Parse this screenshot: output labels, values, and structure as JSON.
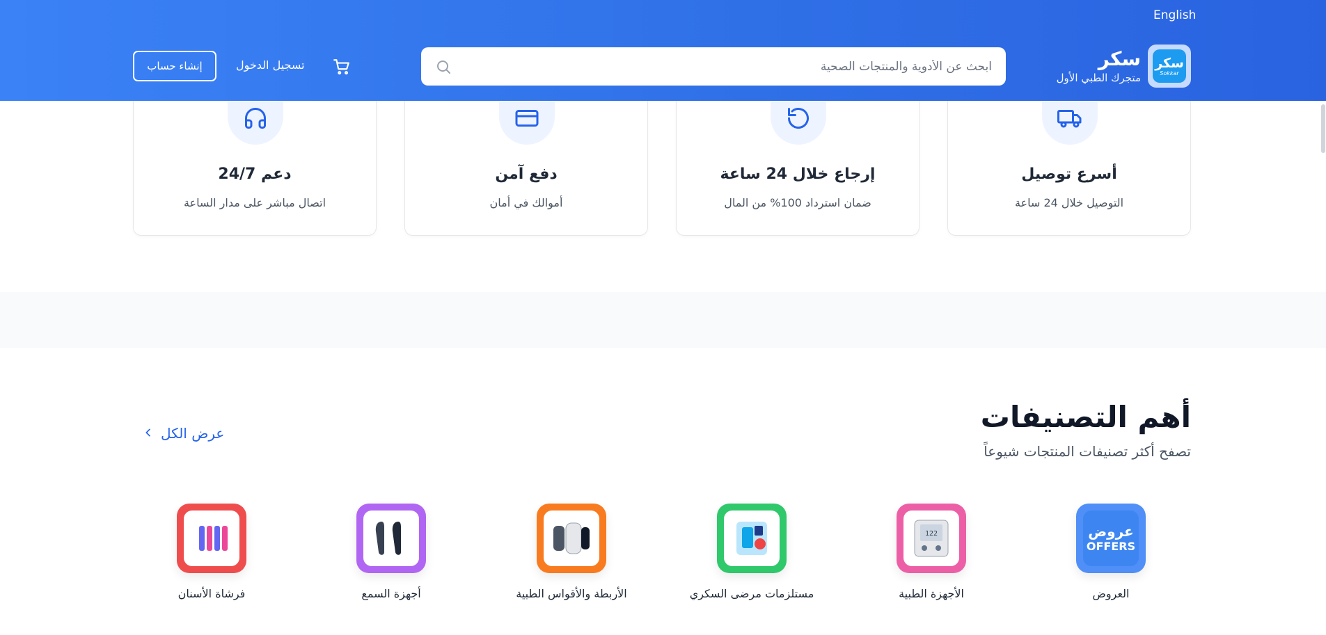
{
  "header": {
    "language_link": "English",
    "brand_name": "سكر",
    "brand_tagline": "متجرك الطبي الأول",
    "logo_text_ar": "سكر",
    "logo_text_en": "Sokkar",
    "search_placeholder": "ابحث عن الأدوية والمنتجات الصحية",
    "login_label": "تسجيل الدخول",
    "signup_label": "إنشاء حساب"
  },
  "features": [
    {
      "title": "أسرع توصيل",
      "subtitle": "التوصيل خلال 24 ساعة",
      "icon": "truck-icon"
    },
    {
      "title": "إرجاع خلال 24 ساعة",
      "subtitle": "ضمان استرداد 100% من المال",
      "icon": "refresh-icon"
    },
    {
      "title": "دفع آمن",
      "subtitle": "أموالك في أمان",
      "icon": "credit-card-icon"
    },
    {
      "title": "دعم 24/7",
      "subtitle": "اتصال مباشر على مدار الساعة",
      "icon": "headphones-icon"
    }
  ],
  "categories_section": {
    "title": "أهم التصنيفات",
    "subtitle": "تصفح أكثر تصنيفات المنتجات شيوعاً",
    "view_all": "عرض الكل"
  },
  "categories": [
    {
      "label": "العروض",
      "color": "#4f8ff7",
      "offers_ar": "عروض",
      "offers_en": "OFFERS"
    },
    {
      "label": "الأجهزة الطبية",
      "color": "#ec5fa6"
    },
    {
      "label": "مستلزمات مرضى السكري",
      "color": "#2fc86a"
    },
    {
      "label": "الأربطة والأقواس الطبية",
      "color": "#f97b1f"
    },
    {
      "label": "أجهزة السمع",
      "color": "#b066f2"
    },
    {
      "label": "فرشاة الأسنان",
      "color": "#ef4d4d"
    }
  ],
  "colors": {
    "header_blue": "#3b82f6",
    "accent_blue": "#2563eb"
  }
}
